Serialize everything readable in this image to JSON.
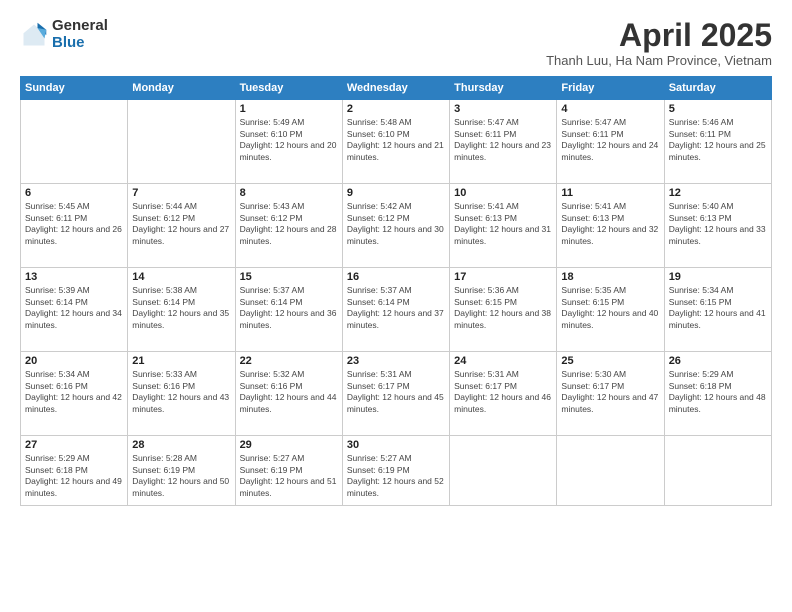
{
  "header": {
    "logo": {
      "general": "General",
      "blue": "Blue"
    },
    "title": "April 2025",
    "location": "Thanh Luu, Ha Nam Province, Vietnam"
  },
  "weekdays": [
    "Sunday",
    "Monday",
    "Tuesday",
    "Wednesday",
    "Thursday",
    "Friday",
    "Saturday"
  ],
  "weeks": [
    [
      {
        "day": "",
        "info": ""
      },
      {
        "day": "",
        "info": ""
      },
      {
        "day": "1",
        "info": "Sunrise: 5:49 AM\nSunset: 6:10 PM\nDaylight: 12 hours and 20 minutes."
      },
      {
        "day": "2",
        "info": "Sunrise: 5:48 AM\nSunset: 6:10 PM\nDaylight: 12 hours and 21 minutes."
      },
      {
        "day": "3",
        "info": "Sunrise: 5:47 AM\nSunset: 6:11 PM\nDaylight: 12 hours and 23 minutes."
      },
      {
        "day": "4",
        "info": "Sunrise: 5:47 AM\nSunset: 6:11 PM\nDaylight: 12 hours and 24 minutes."
      },
      {
        "day": "5",
        "info": "Sunrise: 5:46 AM\nSunset: 6:11 PM\nDaylight: 12 hours and 25 minutes."
      }
    ],
    [
      {
        "day": "6",
        "info": "Sunrise: 5:45 AM\nSunset: 6:11 PM\nDaylight: 12 hours and 26 minutes."
      },
      {
        "day": "7",
        "info": "Sunrise: 5:44 AM\nSunset: 6:12 PM\nDaylight: 12 hours and 27 minutes."
      },
      {
        "day": "8",
        "info": "Sunrise: 5:43 AM\nSunset: 6:12 PM\nDaylight: 12 hours and 28 minutes."
      },
      {
        "day": "9",
        "info": "Sunrise: 5:42 AM\nSunset: 6:12 PM\nDaylight: 12 hours and 30 minutes."
      },
      {
        "day": "10",
        "info": "Sunrise: 5:41 AM\nSunset: 6:13 PM\nDaylight: 12 hours and 31 minutes."
      },
      {
        "day": "11",
        "info": "Sunrise: 5:41 AM\nSunset: 6:13 PM\nDaylight: 12 hours and 32 minutes."
      },
      {
        "day": "12",
        "info": "Sunrise: 5:40 AM\nSunset: 6:13 PM\nDaylight: 12 hours and 33 minutes."
      }
    ],
    [
      {
        "day": "13",
        "info": "Sunrise: 5:39 AM\nSunset: 6:14 PM\nDaylight: 12 hours and 34 minutes."
      },
      {
        "day": "14",
        "info": "Sunrise: 5:38 AM\nSunset: 6:14 PM\nDaylight: 12 hours and 35 minutes."
      },
      {
        "day": "15",
        "info": "Sunrise: 5:37 AM\nSunset: 6:14 PM\nDaylight: 12 hours and 36 minutes."
      },
      {
        "day": "16",
        "info": "Sunrise: 5:37 AM\nSunset: 6:14 PM\nDaylight: 12 hours and 37 minutes."
      },
      {
        "day": "17",
        "info": "Sunrise: 5:36 AM\nSunset: 6:15 PM\nDaylight: 12 hours and 38 minutes."
      },
      {
        "day": "18",
        "info": "Sunrise: 5:35 AM\nSunset: 6:15 PM\nDaylight: 12 hours and 40 minutes."
      },
      {
        "day": "19",
        "info": "Sunrise: 5:34 AM\nSunset: 6:15 PM\nDaylight: 12 hours and 41 minutes."
      }
    ],
    [
      {
        "day": "20",
        "info": "Sunrise: 5:34 AM\nSunset: 6:16 PM\nDaylight: 12 hours and 42 minutes."
      },
      {
        "day": "21",
        "info": "Sunrise: 5:33 AM\nSunset: 6:16 PM\nDaylight: 12 hours and 43 minutes."
      },
      {
        "day": "22",
        "info": "Sunrise: 5:32 AM\nSunset: 6:16 PM\nDaylight: 12 hours and 44 minutes."
      },
      {
        "day": "23",
        "info": "Sunrise: 5:31 AM\nSunset: 6:17 PM\nDaylight: 12 hours and 45 minutes."
      },
      {
        "day": "24",
        "info": "Sunrise: 5:31 AM\nSunset: 6:17 PM\nDaylight: 12 hours and 46 minutes."
      },
      {
        "day": "25",
        "info": "Sunrise: 5:30 AM\nSunset: 6:17 PM\nDaylight: 12 hours and 47 minutes."
      },
      {
        "day": "26",
        "info": "Sunrise: 5:29 AM\nSunset: 6:18 PM\nDaylight: 12 hours and 48 minutes."
      }
    ],
    [
      {
        "day": "27",
        "info": "Sunrise: 5:29 AM\nSunset: 6:18 PM\nDaylight: 12 hours and 49 minutes."
      },
      {
        "day": "28",
        "info": "Sunrise: 5:28 AM\nSunset: 6:19 PM\nDaylight: 12 hours and 50 minutes."
      },
      {
        "day": "29",
        "info": "Sunrise: 5:27 AM\nSunset: 6:19 PM\nDaylight: 12 hours and 51 minutes."
      },
      {
        "day": "30",
        "info": "Sunrise: 5:27 AM\nSunset: 6:19 PM\nDaylight: 12 hours and 52 minutes."
      },
      {
        "day": "",
        "info": ""
      },
      {
        "day": "",
        "info": ""
      },
      {
        "day": "",
        "info": ""
      }
    ]
  ]
}
